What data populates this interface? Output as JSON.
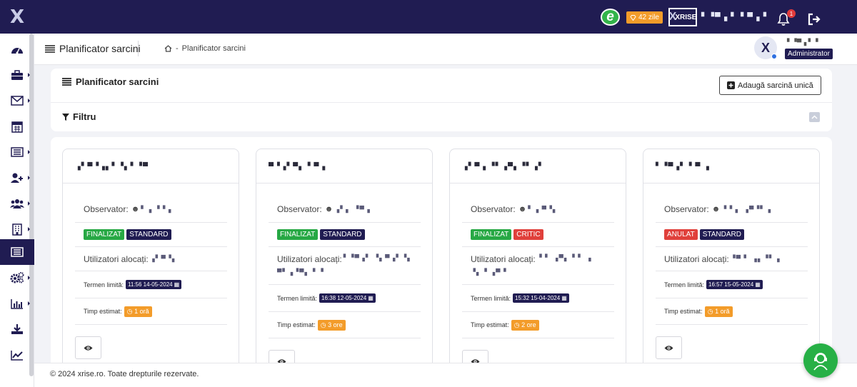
{
  "topbar": {
    "trial_days": "42 zile",
    "brand_label": "XRISE",
    "company_name": "▘▝▀▗ ▘▝ ▀▗▝",
    "notifications_count": "1"
  },
  "sidebar": {
    "items": [
      {
        "icon": "dashboard-icon"
      },
      {
        "icon": "briefcase-icon"
      },
      {
        "icon": "mail-icon"
      },
      {
        "icon": "calendar-icon"
      },
      {
        "icon": "list-icon"
      },
      {
        "icon": "add-user-icon"
      },
      {
        "icon": "users-icon"
      },
      {
        "icon": "building-icon"
      },
      {
        "icon": "tasks-icon",
        "active": true
      },
      {
        "icon": "settings-icon"
      },
      {
        "icon": "chart-bar-icon"
      },
      {
        "icon": "download-icon"
      },
      {
        "icon": "line-chart-icon"
      }
    ]
  },
  "header": {
    "title": "Planificator sarcini",
    "breadcrumb_separator": "-",
    "breadcrumb_current": "Planificator sarcini",
    "user_name": "▘▝▀▗ ▘▝",
    "user_role": "Administrator"
  },
  "top_panel": {
    "title": "Planificator sarcini",
    "add_button": "Adaugă sarcină unică",
    "filter_label": "Filtru"
  },
  "labels": {
    "observer": "Observator:",
    "allocated": "Utilizatori alocați:",
    "deadline": "Termen limită:",
    "estimate": "Timp estimat:"
  },
  "cards": [
    {
      "title": "▗▘▀▝▗▖▘▝▖▘▝▀",
      "observer": "▘▗ ▝ ▘▖",
      "status": "FINALIZAT",
      "priority": "STANDARD",
      "users_line1": "▗▘▀▝▖",
      "users_line2": "",
      "deadline": "11:56 14-05-2024",
      "estimate": "1 oră"
    },
    {
      "title": "▀▝▗▘▀▖▝ ▀▗",
      "observer": "▗▘▖ ▝▀▗",
      "status": "FINALIZAT",
      "priority": "STANDARD",
      "users_line1": "▘▝▀▗▘ ▝▖▀▗▘▝▖",
      "users_line2": "▀▘▗▝▀▖ ▘▝",
      "deadline": "16:38 12-05-2024",
      "estimate": "3 ore"
    },
    {
      "title": "▗▘▀ ▖▝▘▗▀▖▝▘▗▘",
      "observer": "▘▗ ▀▝▖",
      "status": "FINALIZAT",
      "priority": "CRITIC",
      "users_line1": "▝ ▘ ▗▀▖▝ ▘ ▗",
      "users_line2": "▝▖ ▘▗▀▝",
      "deadline": "15:32 15-04-2024",
      "estimate": "2 ore"
    },
    {
      "title": "▘▝▀▗▘▝ ▀ ▗",
      "observer": "▝ ▘▖ ▗▀▝▘▗",
      "status": "ANULAT",
      "priority": "STANDARD",
      "users_line1": "▝▀ ▘ ▗▖▝▘▗",
      "users_line2": "",
      "deadline": "16:57 15-05-2024",
      "estimate": "1 oră"
    }
  ],
  "footer": {
    "text": "© 2024 xrise.ro. Toate drepturile rezervate."
  }
}
